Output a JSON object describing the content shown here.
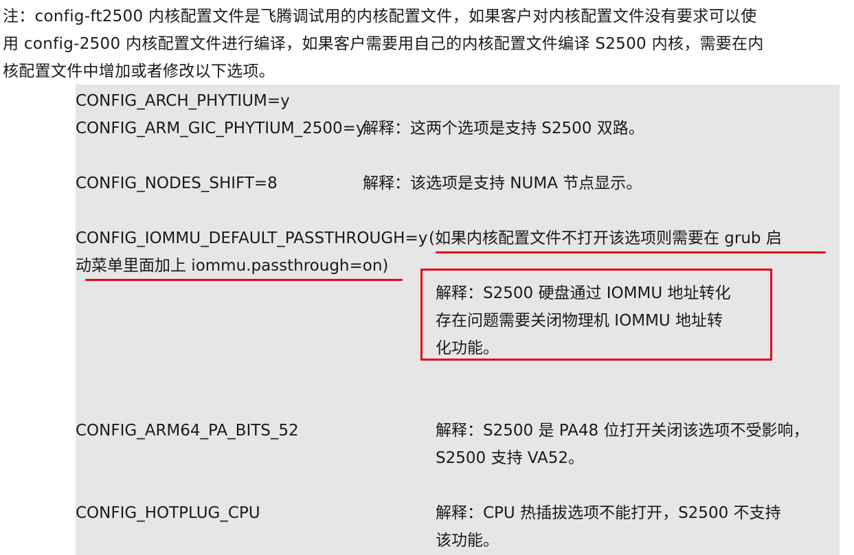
{
  "intro": {
    "line1": "注：config-ft2500 内核配置文件是飞腾调试用的内核配置文件，如果客户对内核配置文件没有要求可以使",
    "line2": "用 config-2500 内核配置文件进行编译，如果客户需要用自己的内核配置文件编译 S2500 内核，需要在内",
    "line3": "核配置文件中增加或者修改以下选项。"
  },
  "options": {
    "arch_phytium": "CONFIG_ARCH_PHYTIUM=y",
    "gic_phytium": "CONFIG_ARM_GIC_PHYTIUM_2500=y",
    "gic_note": "解释：这两个选项是支持 S2500 双路。",
    "nodes_shift": "CONFIG_NODES_SHIFT=8",
    "nodes_note": "解释：该选项是支持 NUMA 节点显示。",
    "iommu_name": "CONFIG_IOMMU_DEFAULT_PASSTHROUGH=y",
    "iommu_paren_1": "(如果内核配置文件不打开该选项则需要在 grub 启",
    "iommu_paren_2": "动菜单里面加上 iommu.passthrough=on)",
    "iommu_note_1": "解释：S2500 硬盘通过 IOMMU 地址转化",
    "iommu_note_2": "存在问题需要关闭物理机 IOMMU 地址转",
    "iommu_note_3": "化功能。",
    "pa_bits": "CONFIG_ARM64_PA_BITS_52",
    "pa_note_1": "解释：S2500 是 PA48 位打开关闭该选项不受影响，",
    "pa_note_2": "S2500 支持 VA52。",
    "hotplug": "CONFIG_HOTPLUG_CPU",
    "hotplug_note_1": "解释：CPU 热插拔选项不能打开，S2500 不支持",
    "hotplug_note_2": "该功能。"
  },
  "annotation_color": "#e60012",
  "block_background": "#e6e6e6"
}
